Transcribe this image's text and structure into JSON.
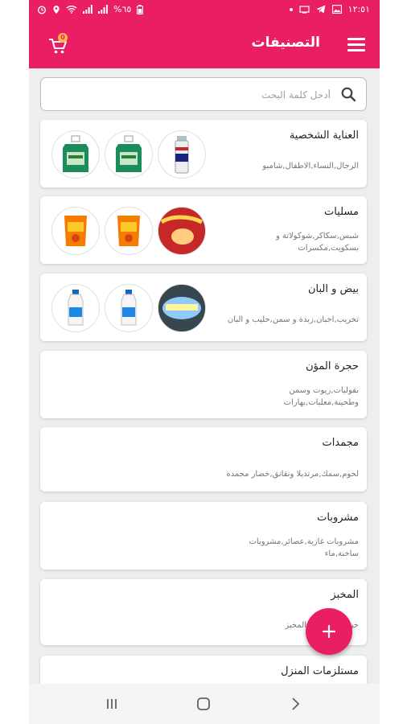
{
  "status_bar": {
    "time": "١٢:٥١",
    "battery": "%٦٥"
  },
  "header": {
    "title": "التصنيفات",
    "cart_count": "0"
  },
  "search": {
    "placeholder": "أدخل كلمة البحث"
  },
  "categories": [
    {
      "title": "العناية الشخصية",
      "subtitle": "الرجال,النساء,الاطفال,شامبو",
      "thumbs": [
        "deodorant-can-image",
        "detergent-bottle-image",
        "detergent-bottle-image"
      ]
    },
    {
      "title": "مسليات",
      "subtitle": "شبس,سكاكر,شوكولاتة و بسكويت,مكسرات",
      "thumbs": [
        "pringles-chips-image",
        "chips-bag-image",
        "chips-bag-image"
      ]
    },
    {
      "title": "بيض و البان",
      "subtitle": "تحريب,اجبان,زبدة و سمن,حليب و البان",
      "thumbs": [
        "cheese-tub-image",
        "milk-bottle-image",
        "milk-bottle-image"
      ]
    },
    {
      "title": "حجرة المؤن",
      "subtitle": "بقوليات,زيوت وسمن وطحينة,معلبات,بهارات",
      "thumbs": []
    },
    {
      "title": "مجمدات",
      "subtitle": "لحوم,سمك,مرتديلا ونقانق,خضار مجمدة",
      "thumbs": []
    },
    {
      "title": "مشروبات",
      "subtitle": "مشروبات غازية,عصائر,مشروبات ساخنة,ماء",
      "thumbs": []
    },
    {
      "title": "المخبز",
      "subtitle": "خبز,مستلزمات المخبز",
      "thumbs": []
    },
    {
      "title": "مستلزمات المنزل",
      "subtitle": "",
      "thumbs": []
    }
  ],
  "fab": {
    "icon": "plus-icon",
    "label": "+"
  },
  "colors": {
    "primary": "#e91e63",
    "background": "#eeeeee"
  }
}
